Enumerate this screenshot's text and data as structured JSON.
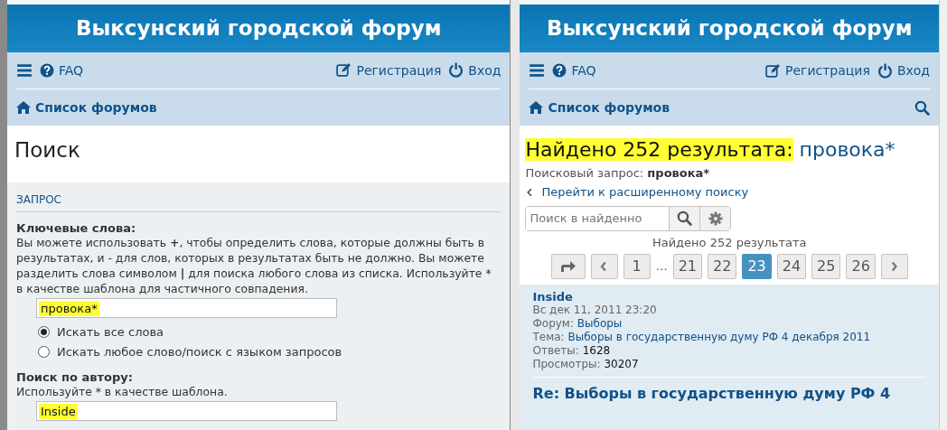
{
  "search_window": {
    "site_title": "Выксунский городской форум",
    "nav": {
      "faq": "FAQ",
      "register": "Регистрация",
      "login": "Вход",
      "breadcrumb": "Список форумов",
      "search_icon": false
    },
    "page_title": "Поиск",
    "panel": {
      "section": "ЗАПРОС",
      "fields": [
        {
          "label": "Ключевые слова:",
          "help": "Вы можете использовать **+**, чтобы определить слова, которые должны быть в результатах, и - для слов, которых в результатах быть не должно. Вы можете разделить слова символом **|** для поиска любого слова из списка. Используйте * в качестве шаблона для частичного совпадения.",
          "value": "провока*",
          "highlighted": true,
          "options": [
            {
              "label": "Искать все слова",
              "selected": true
            },
            {
              "label": "Искать любое слово/поиск с языком запросов",
              "selected": false
            }
          ]
        },
        {
          "label": "Поиск по автору:",
          "help": "Используйте * в качестве шаблона.",
          "value": "Inside",
          "highlighted": true
        }
      ]
    }
  },
  "results_window": {
    "site_title": "Выксунский городской форум",
    "nav": {
      "faq": "FAQ",
      "register": "Регистрация",
      "login": "Вход",
      "breadcrumb": "Список форумов",
      "search_icon": true
    },
    "heading": {
      "text": "Найдено 252 результата:",
      "highlighted": true,
      "query": "провока*"
    },
    "query_line": {
      "label": "Поисковый запрос:",
      "value": "провока*"
    },
    "back_link": "Перейти к расширенному поиску",
    "filter": {
      "placeholder": "Поиск в найденно"
    },
    "count": "Найдено 252 результата",
    "pagination": [
      {
        "kind": "jump"
      },
      {
        "kind": "prev"
      },
      {
        "kind": "page",
        "label": "1",
        "selected": false
      },
      {
        "kind": "ellipsis",
        "label": "…"
      },
      {
        "kind": "page",
        "label": "21",
        "selected": false
      },
      {
        "kind": "page",
        "label": "22",
        "selected": false
      },
      {
        "kind": "page",
        "label": "23",
        "selected": true
      },
      {
        "kind": "page",
        "label": "24",
        "selected": false
      },
      {
        "kind": "page",
        "label": "25",
        "selected": false
      },
      {
        "kind": "page",
        "label": "26",
        "selected": false
      },
      {
        "kind": "next"
      }
    ],
    "results": [
      {
        "author": "Inside",
        "date": "Вс дек 11, 2011 23:20",
        "fields": [
          {
            "label": "Форум:",
            "value": "Выборы",
            "kind": "link"
          },
          {
            "label": "Тема:",
            "value": "Выборы в государственную думу РФ 4 декабря 2011",
            "kind": "link"
          },
          {
            "label": "Ответы:",
            "value": "1628",
            "kind": "plain"
          },
          {
            "label": "Просмотры:",
            "value": "30207",
            "kind": "plain"
          }
        ],
        "title": "Re: Выборы в государственную думу РФ 4"
      }
    ]
  }
}
